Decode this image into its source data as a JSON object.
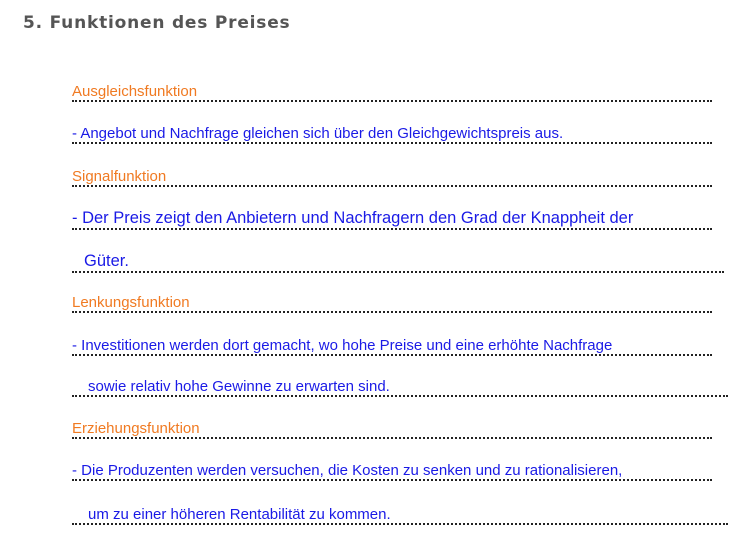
{
  "section": {
    "title": "5. Funktionen des Preises"
  },
  "lines": {
    "l1": "Ausgleichsfunktion",
    "l2": "- Angebot und Nachfrage gleichen sich über den Gleichgewichtspreis aus.",
    "l3": "Signalfunktion",
    "l4": "- Der Preis zeigt den Anbietern und Nachfragern den Grad der Knappheit der",
    "l5": "Güter.",
    "l6": "Lenkungsfunktion",
    "l7": "- Investitionen werden dort gemacht, wo hohe Preise und eine erhöhte Nachfrage",
    "l8": "sowie relativ hohe Gewinne zu erwarten sind.",
    "l9": "Erziehungsfunktion",
    "l10": "- Die Produzenten werden versuchen, die Kosten zu senken und zu rationalisieren,",
    "l11": "um zu einer höheren Rentabilität zu kommen."
  },
  "colors": {
    "heading": "#555555",
    "function_name": "#f07a22",
    "description": "#1a1ae6"
  }
}
